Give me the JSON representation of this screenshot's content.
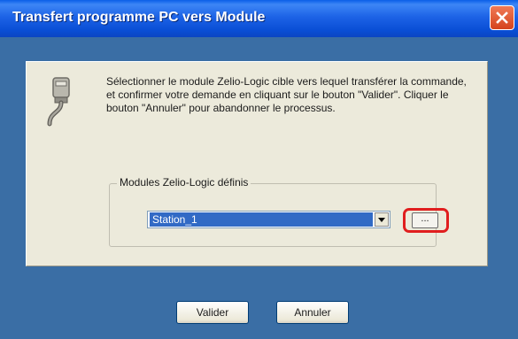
{
  "window": {
    "title": "Transfert programme PC vers Module"
  },
  "dialog": {
    "instructions": "Sélectionner le module Zelio-Logic cible vers lequel transférer la commande, et confirmer votre demande en cliquant sur le bouton \"Valider\". Cliquer le bouton \"Annuler\" pour abandonner le processus.",
    "group_label": "Modules Zelio-Logic définis",
    "selected_module": "Station_1",
    "browse_label": "..."
  },
  "buttons": {
    "validate_label": "Valider",
    "cancel_label": "Annuler"
  },
  "icons": {
    "title_close": "close-icon",
    "connector": "serial-plug-icon",
    "combo_arrow": "chevron-down-icon"
  },
  "colors": {
    "titlebar": "#0a4fd6",
    "client_background": "#3a6ea5",
    "panel_background": "#eceadb",
    "selection": "#316ac5",
    "highlight_ring": "#e01e1e"
  }
}
